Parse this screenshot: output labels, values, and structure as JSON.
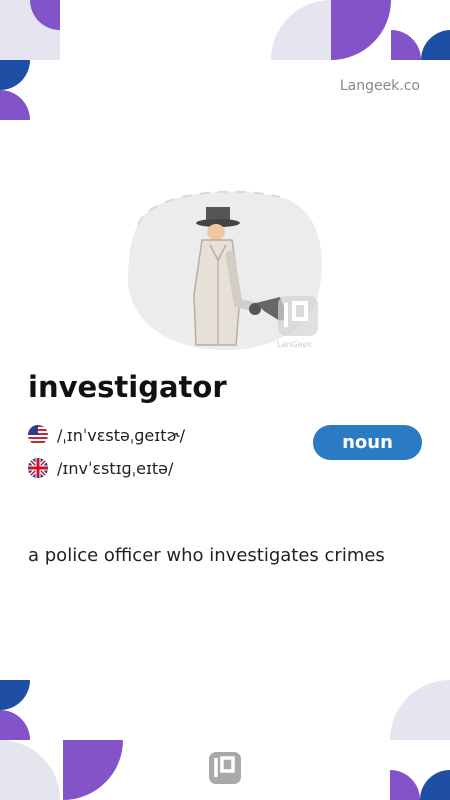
{
  "brand": {
    "site": "Langeek.co",
    "watermark_text": "LanGeek"
  },
  "entry": {
    "word": "investigator",
    "part_of_speech": "noun",
    "pronunciations": [
      {
        "region": "US",
        "flag_icon": "us-flag-icon",
        "ipa": "/ˌɪnˈvɛstəˌɡeɪtɚ/"
      },
      {
        "region": "UK",
        "flag_icon": "uk-flag-icon",
        "ipa": "/ɪnvˈɛstɪɡˌeɪtə/"
      }
    ],
    "definition": "a police officer who investigates crimes"
  },
  "colors": {
    "purple": "#8353c9",
    "navy": "#1e4fa5",
    "light_gray": "#e4e5ef",
    "badge_blue": "#2a7bc3"
  }
}
